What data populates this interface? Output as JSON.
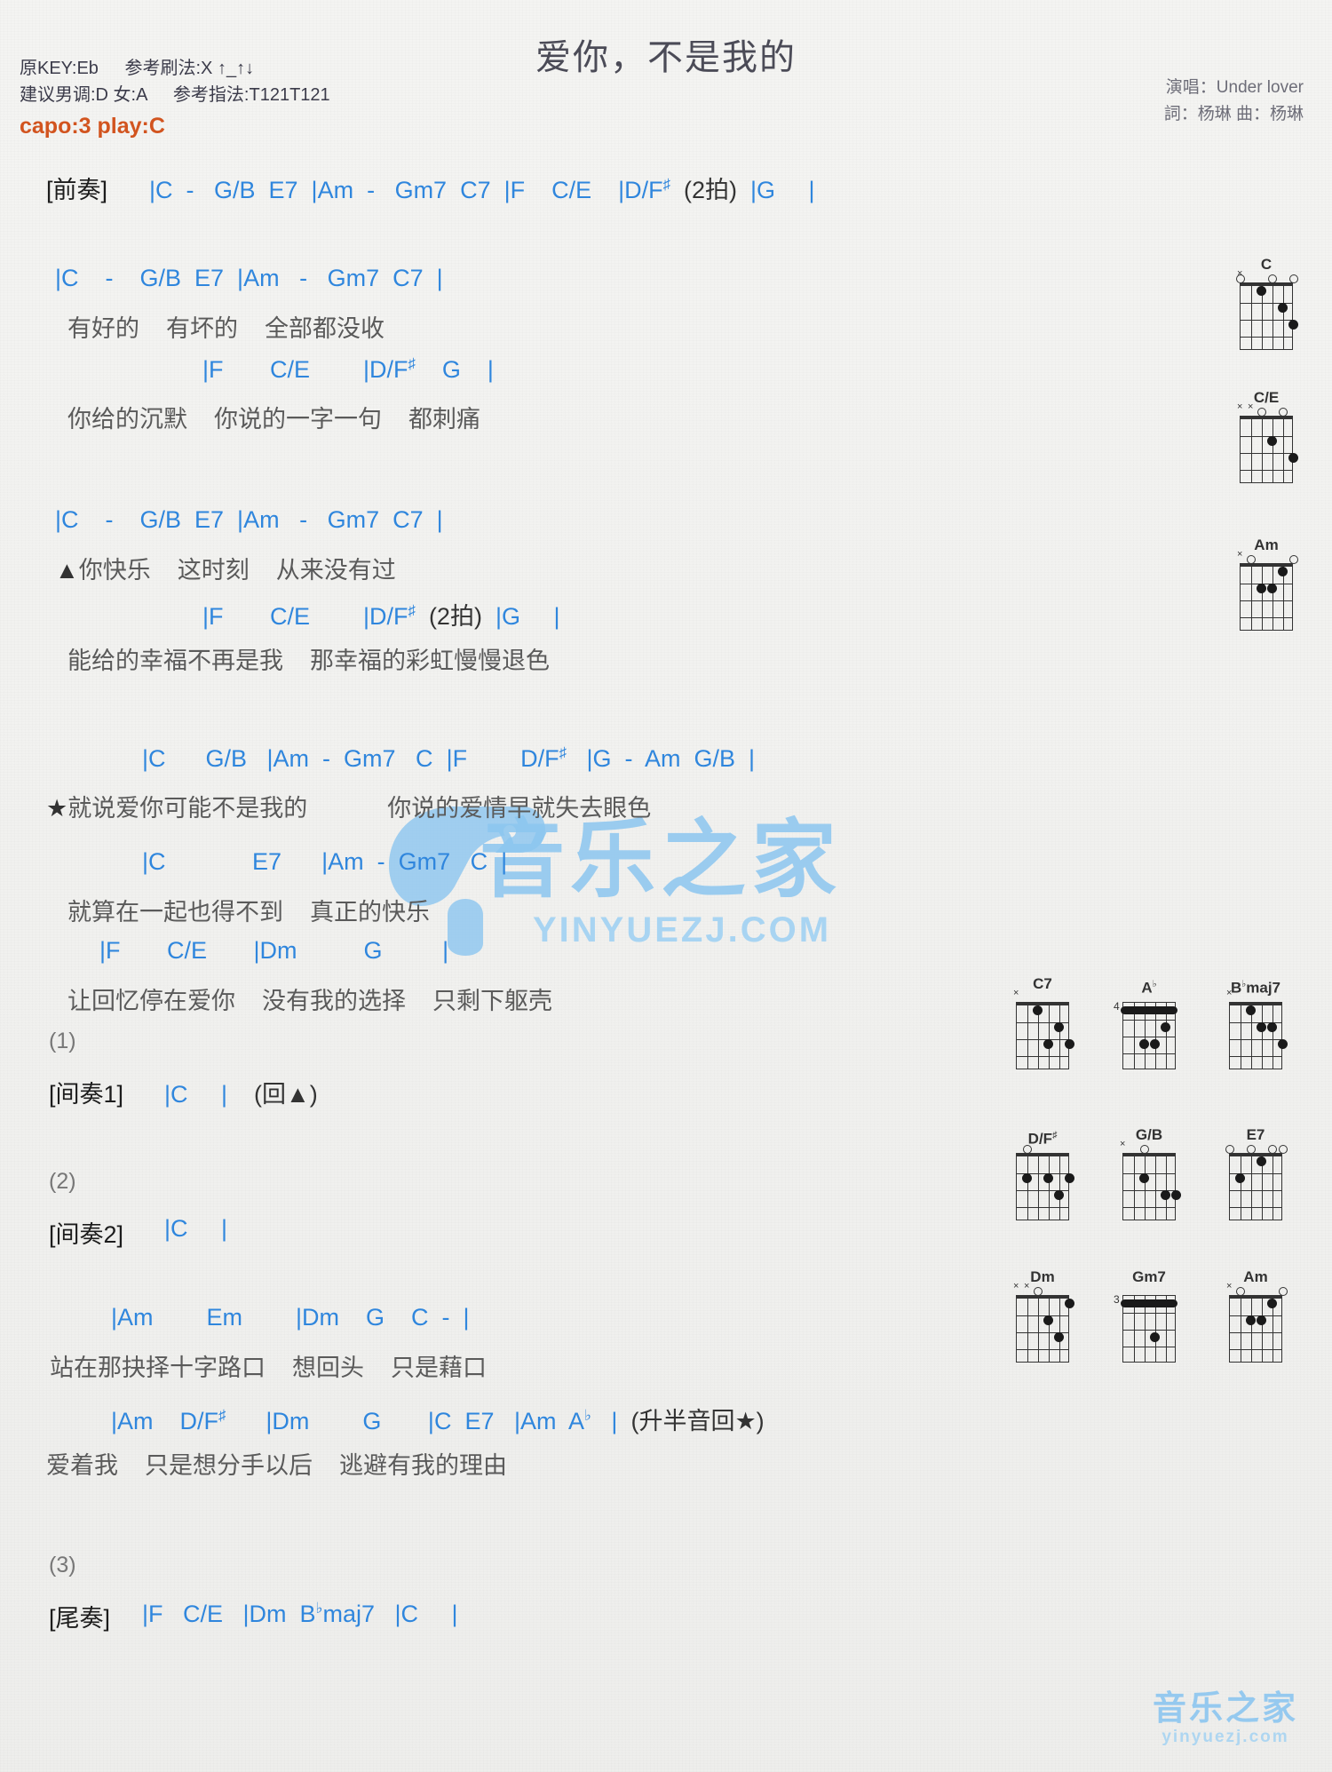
{
  "header": {
    "title": "爱你，不是我的",
    "original_key_label": "原KEY:Eb",
    "suggested_key_label": "建议男调:D 女:A",
    "strum_label": "参考刷法:X ↑_↑↓",
    "fingering_label": "参考指法:T121T121",
    "capo_label": "capo:3 play:C",
    "singer": "演唱：Under lover",
    "writer": "詞：杨琳   曲：杨琳"
  },
  "sections": [
    {
      "name": "intro",
      "label": "[前奏]",
      "chords": "|C  -   G/B  E7  |Am  -   Gm7  C7  |F    C/E    |D/F#  (2拍)  |G     |",
      "lyric": ""
    },
    {
      "name": "verse1-line1",
      "label": "",
      "chords": "|C    -    G/B  E7  |Am   -   Gm7  C7  |",
      "lyric": "有好的    有坏的    全部都没收"
    },
    {
      "name": "verse1-line2",
      "label": "",
      "chords": "|F       C/E        |D/F#    G    |",
      "lyric": "你给的沉默    你说的一字一句    都刺痛"
    },
    {
      "name": "verse2-line1",
      "label": "",
      "chords": "|C    -    G/B  E7  |Am   -   Gm7  C7  |",
      "lyric": "▲你快乐    这时刻    从来没有过"
    },
    {
      "name": "verse2-line2",
      "label": "",
      "chords": "|F       C/E        |D/F#  (2拍)  |G     |",
      "lyric": "能给的幸福不再是我    那幸福的彩虹慢慢退色"
    },
    {
      "name": "chorus-line1",
      "label": "",
      "chords": "|C      G/B   |Am  -  Gm7   C  |F        D/F#   |G  -  Am  G/B  |",
      "lyric": "★就说爱你可能不是我的            你说的爱情早就失去眼色"
    },
    {
      "name": "chorus-line2",
      "label": "",
      "chords": "|C             E7      |Am  -  Gm7   C  |",
      "lyric": "就算在一起也得不到    真正的快乐"
    },
    {
      "name": "chorus-line3",
      "label": "",
      "chords": "|F       C/E       |Dm          G         |",
      "lyric": "让回忆停在爱你    没有我的选择    只剩下躯壳"
    },
    {
      "name": "interlude1",
      "label": "[间奏1]",
      "number": "(1)",
      "chords": "|C     |    (回▲)",
      "lyric": ""
    },
    {
      "name": "interlude2",
      "label": "[间奏2]",
      "number": "(2)",
      "chords": "|C     |",
      "lyric": ""
    },
    {
      "name": "bridge-line1",
      "label": "",
      "chords": "|Am        Em        |Dm    G    C  -  |",
      "lyric": "站在那抉择十字路口    想回头    只是藉口"
    },
    {
      "name": "bridge-line2",
      "label": "",
      "chords": "|Am    D/F#      |Dm        G       |C  E7   |Am  Ab   |  (升半音回★)",
      "lyric": "爱着我    只是想分手以后    逃避有我的理由"
    },
    {
      "name": "outro",
      "label": "[尾奏]",
      "number": "(3)",
      "chords": "|F   C/E   |Dm  Bbmaj7   |C     |",
      "lyric": ""
    }
  ],
  "chord_diagrams_right": [
    {
      "name": "C",
      "markers": [
        "x",
        "",
        "",
        "",
        "",
        ""
      ],
      "opens": [
        0,
        3,
        5
      ],
      "dots": [
        {
          "s": 2,
          "f": 1
        },
        {
          "s": 4,
          "f": 2
        },
        {
          "s": 5,
          "f": 3
        }
      ],
      "start_fret": ""
    },
    {
      "name": "C/E",
      "markers": [
        "x",
        "x",
        "",
        "",
        "",
        ""
      ],
      "opens": [
        2,
        4
      ],
      "dots": [
        {
          "s": 3,
          "f": 2
        },
        {
          "s": 5,
          "f": 3
        }
      ],
      "start_fret": ""
    },
    {
      "name": "Am",
      "markers": [
        "x",
        "",
        "",
        "",
        "",
        ""
      ],
      "opens": [
        1,
        5
      ],
      "dots": [
        {
          "s": 2,
          "f": 2
        },
        {
          "s": 3,
          "f": 2
        },
        {
          "s": 4,
          "f": 1
        }
      ],
      "start_fret": ""
    }
  ],
  "chord_diagrams_grid": [
    {
      "name": "C7",
      "markers": [
        "x",
        "",
        "",
        "",
        "",
        ""
      ],
      "opens": [],
      "dots": [
        {
          "s": 2,
          "f": 1
        },
        {
          "s": 3,
          "f": 3
        },
        {
          "s": 4,
          "f": 2
        },
        {
          "s": 5,
          "f": 3
        }
      ],
      "start_fret": ""
    },
    {
      "name": "Ab",
      "markers": [],
      "opens": [],
      "barre": {
        "f": 1
      },
      "dots": [
        {
          "s": 2,
          "f": 3
        },
        {
          "s": 3,
          "f": 3
        },
        {
          "s": 4,
          "f": 2
        }
      ],
      "start_fret": "4"
    },
    {
      "name": "Bbmaj7",
      "markers": [
        "x",
        "",
        "",
        "",
        "",
        ""
      ],
      "opens": [],
      "dots": [
        {
          "s": 2,
          "f": 1
        },
        {
          "s": 3,
          "f": 2
        },
        {
          "s": 4,
          "f": 2
        },
        {
          "s": 5,
          "f": 3
        }
      ],
      "start_fret": ""
    },
    {
      "name": "D/F#",
      "markers": [],
      "opens": [
        1
      ],
      "dots": [
        {
          "s": 1,
          "f": 2
        },
        {
          "s": 3,
          "f": 2
        },
        {
          "s": 4,
          "f": 3
        },
        {
          "s": 5,
          "f": 2
        }
      ],
      "start_fret": ""
    },
    {
      "name": "G/B",
      "markers": [
        "x",
        ""
      ],
      "opens": [
        2
      ],
      "dots": [
        {
          "s": 2,
          "f": 2
        },
        {
          "s": 4,
          "f": 3
        },
        {
          "s": 5,
          "f": 3
        }
      ],
      "start_fret": ""
    },
    {
      "name": "E7",
      "markers": [],
      "opens": [
        0,
        2,
        4,
        5
      ],
      "dots": [
        {
          "s": 1,
          "f": 2
        },
        {
          "s": 3,
          "f": 1
        }
      ],
      "start_fret": ""
    },
    {
      "name": "Dm",
      "markers": [
        "x",
        "x"
      ],
      "opens": [
        2
      ],
      "dots": [
        {
          "s": 3,
          "f": 2
        },
        {
          "s": 4,
          "f": 3
        },
        {
          "s": 5,
          "f": 1
        }
      ],
      "start_fret": ""
    },
    {
      "name": "Gm7",
      "markers": [],
      "opens": [],
      "barre": {
        "f": 1
      },
      "dots": [
        {
          "s": 3,
          "f": 3
        }
      ],
      "start_fret": "3"
    },
    {
      "name": "Am",
      "markers": [
        "x",
        "",
        "",
        "",
        "",
        ""
      ],
      "opens": [
        1,
        5
      ],
      "dots": [
        {
          "s": 2,
          "f": 2
        },
        {
          "s": 3,
          "f": 2
        },
        {
          "s": 4,
          "f": 1
        }
      ],
      "start_fret": ""
    }
  ],
  "watermark": {
    "center_text": "音乐之家",
    "center_url": "YINYUEZJ.COM",
    "bottom_text": "音乐之家",
    "bottom_url": "yinyuezj.com"
  },
  "colors": {
    "chord": "#2f86dd",
    "lyric": "#5a5a5a",
    "capo": "#d2541f",
    "watermark": "#8cc6f0"
  }
}
